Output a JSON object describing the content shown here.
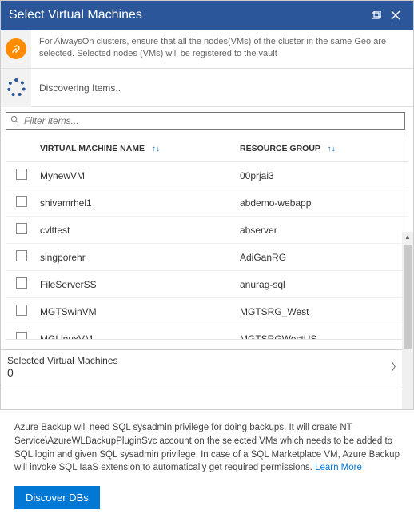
{
  "header": {
    "title": "Select Virtual Machines"
  },
  "infoBanner": "For AlwaysOn clusters, ensure that all the nodes(VMs) of the cluster in the same Geo are selected. Selected nodes (VMs) will be registered to the vault",
  "discovery": {
    "text": "Discovering Items.."
  },
  "filter": {
    "placeholder": "Filter items..."
  },
  "columns": {
    "name": "VIRTUAL MACHINE NAME",
    "group": "RESOURCE GROUP"
  },
  "rows": [
    {
      "name": "MynewVM",
      "group": "00prjai3"
    },
    {
      "name": "shivamrhel1",
      "group": "abdemo-webapp"
    },
    {
      "name": "cvlttest",
      "group": "abserver"
    },
    {
      "name": "singporehr",
      "group": "AdiGanRG"
    },
    {
      "name": "FileServerSS",
      "group": "anurag-sql"
    },
    {
      "name": "MGTSwinVM",
      "group": "MGTSRG_West"
    },
    {
      "name": "MGLinuxVM",
      "group": "MGTSRGWestUS"
    }
  ],
  "selected": {
    "label": "Selected Virtual Machines",
    "count": "0"
  },
  "footer": {
    "text": "Azure Backup will need SQL sysadmin privilege for doing backups. It will create NT Service\\AzureWLBackupPluginSvc account on the selected VMs which needs to be added to SQL login and given SQL sysadmin privilege. In case of a SQL Marketplace VM, Azure Backup will invoke SQL IaaS extension to automatically get required permissions. ",
    "learnMore": "Learn More",
    "button": "Discover DBs"
  }
}
